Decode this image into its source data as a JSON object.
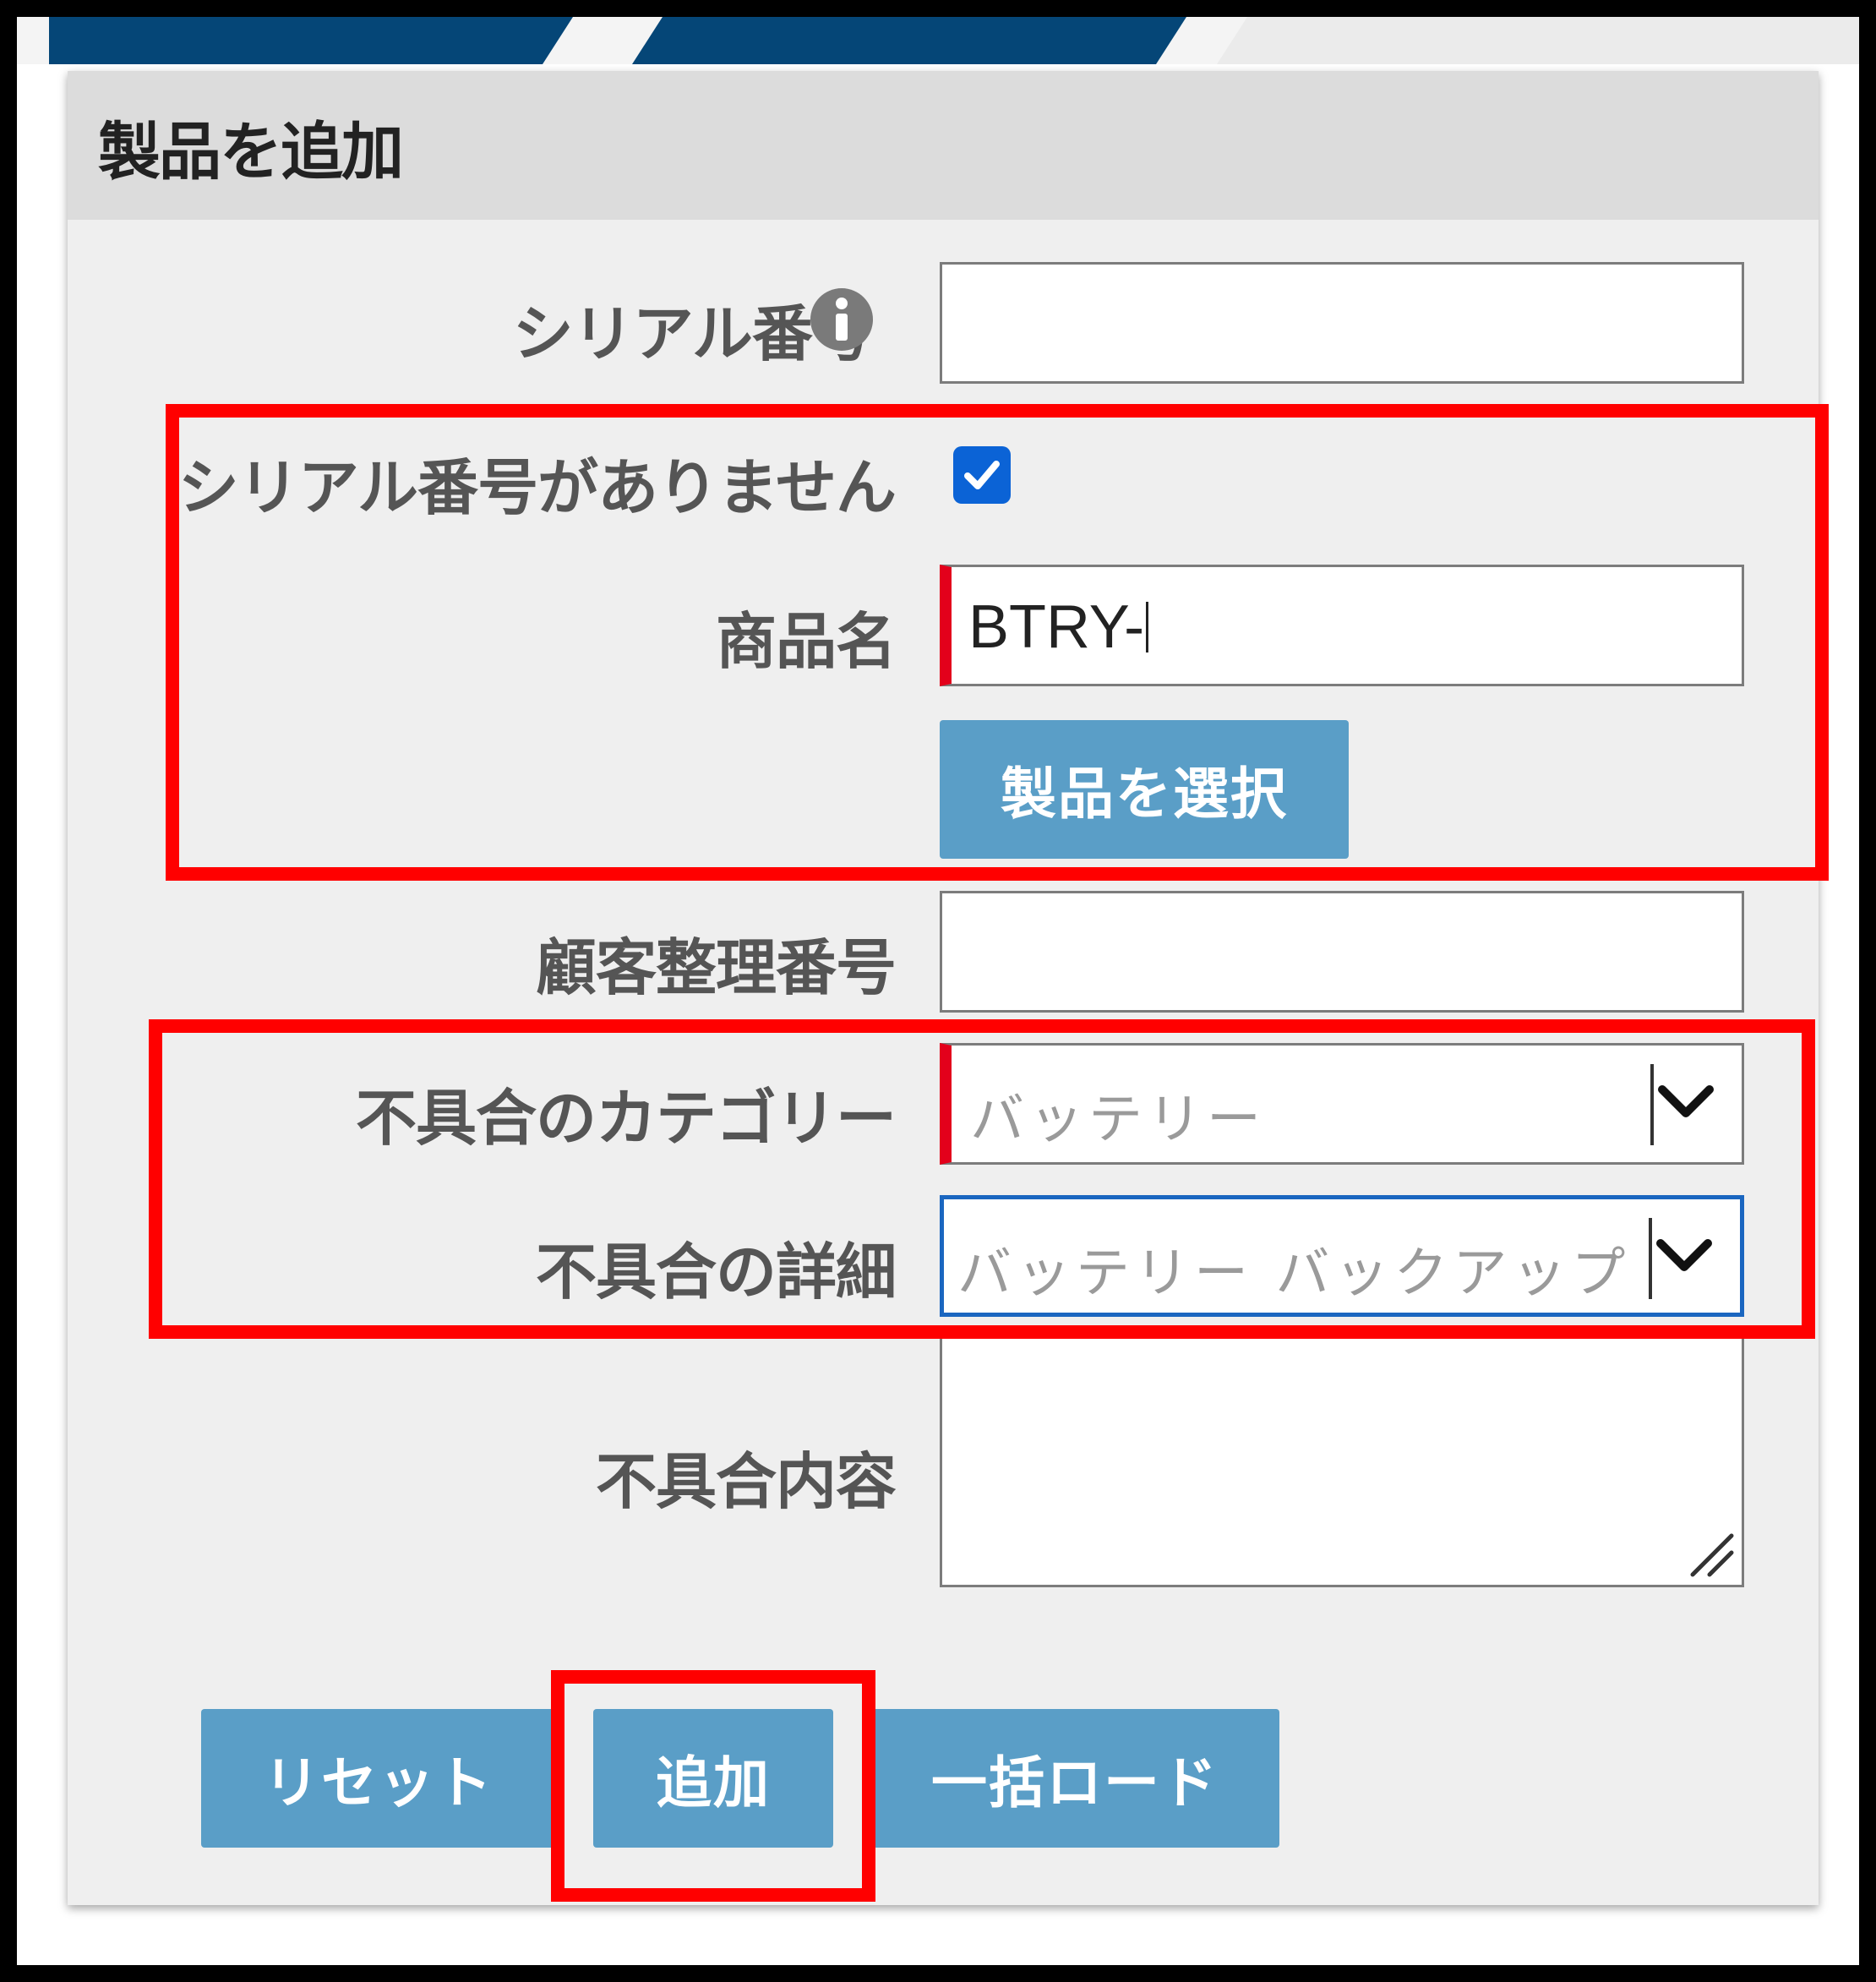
{
  "dialog": {
    "title": "製品を追加"
  },
  "form": {
    "serial_number": {
      "label": "シリアル番号",
      "value": ""
    },
    "no_serial": {
      "label": "シリアル番号がありません",
      "checked": true
    },
    "product_name": {
      "label": "商品名",
      "value": "BTRY-"
    },
    "select_product_button": "製品を選択",
    "customer_ref": {
      "label": "顧客整理番号",
      "value": ""
    },
    "defect_category": {
      "label": "不具合のカテゴリー",
      "value": "バッテリー"
    },
    "defect_detail": {
      "label": "不具合の詳細",
      "value": "バッテリー バックアップ"
    },
    "defect_content": {
      "label": "不具合内容",
      "value": ""
    }
  },
  "buttons": {
    "reset": "リセット",
    "add": "追加",
    "bulk_load": "一括ロード"
  },
  "colors": {
    "button": "#5a9ec7",
    "required_marker": "#e3001b",
    "highlight": "#ff0000",
    "focus": "#1a66c0",
    "checkbox": "#0b63d6",
    "banner": "#054677"
  }
}
